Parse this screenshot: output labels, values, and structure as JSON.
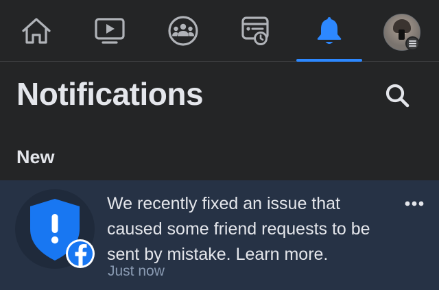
{
  "nav": {
    "items": [
      {
        "icon": "home-icon"
      },
      {
        "icon": "video-icon"
      },
      {
        "icon": "groups-icon"
      },
      {
        "icon": "feeds-icon"
      },
      {
        "icon": "bell-icon"
      },
      {
        "icon": "profile-avatar"
      }
    ],
    "active": "bell-icon",
    "accent_color": "#2d88ff"
  },
  "header": {
    "title": "Notifications",
    "search_icon": "search-icon"
  },
  "section": {
    "title": "New"
  },
  "notifications": [
    {
      "text": "We recently fixed an issue that caused some friend requests to be sent by mistake. Learn more.",
      "time": "Just now",
      "icon": "shield-alert-icon",
      "badge": "facebook-badge-icon",
      "unread_bg": "#263245"
    }
  ],
  "colors": {
    "background": "#242526",
    "text": "#e4e6eb",
    "shield_blue": "#1877f2"
  }
}
